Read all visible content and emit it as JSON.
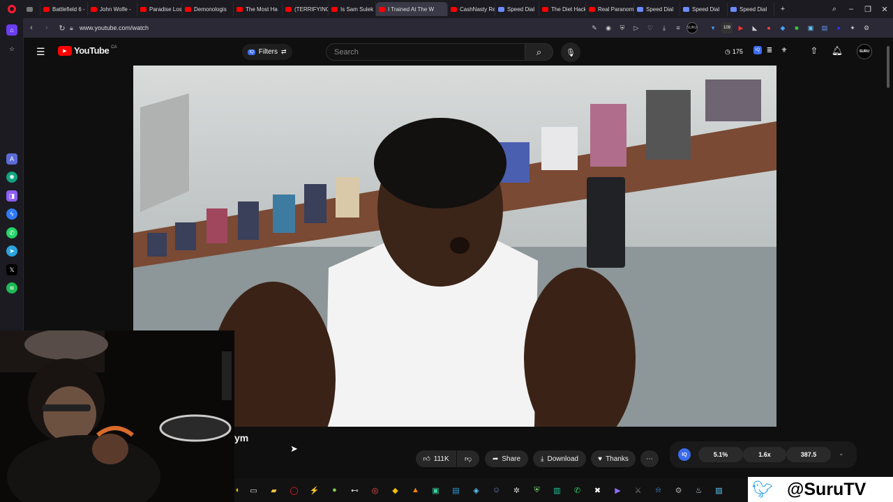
{
  "browser": {
    "tabs": [
      {
        "label": "Battlefield 6 -",
        "kind": "yt"
      },
      {
        "label": "John Wolfe -",
        "kind": "yt"
      },
      {
        "label": "Paradise Lost",
        "kind": "yt"
      },
      {
        "label": "Demonologis",
        "kind": "yt"
      },
      {
        "label": "The Most Ha",
        "kind": "yt"
      },
      {
        "label": "(TERRIFYING)",
        "kind": "yt"
      },
      {
        "label": "Is Sam Sulek",
        "kind": "yt"
      },
      {
        "label": "I Trained At The W",
        "kind": "yt",
        "active": true
      },
      {
        "label": "CashNasty Re",
        "kind": "yt"
      },
      {
        "label": "Speed Dial",
        "kind": "sd"
      },
      {
        "label": "The Diet Hack",
        "kind": "yt"
      },
      {
        "label": "Real Paranorm",
        "kind": "yt"
      },
      {
        "label": "Speed Dial",
        "kind": "sd"
      },
      {
        "label": "Speed Dial",
        "kind": "sd"
      },
      {
        "label": "Speed Dial",
        "kind": "sd"
      }
    ],
    "url": "www.youtube.com/watch",
    "ext_badge": "109"
  },
  "youtube": {
    "logo": "YouTube",
    "region": "CA",
    "filters_label": "Filters",
    "search_placeholder": "Search",
    "history_count": "175",
    "avatar": "SURU",
    "title_fragment": "ym",
    "likes": "111K",
    "share": "Share",
    "download": "Download",
    "thanks": "Thanks",
    "iq_label": "IQ",
    "stats": [
      "5.1%",
      "1.6x",
      "387.5"
    ]
  },
  "overlay": {
    "handle": "@SuruTV"
  },
  "colors": {
    "accent": "#ff0000",
    "twitter": "#1d9bf0",
    "opera": "#ff1b2d"
  }
}
